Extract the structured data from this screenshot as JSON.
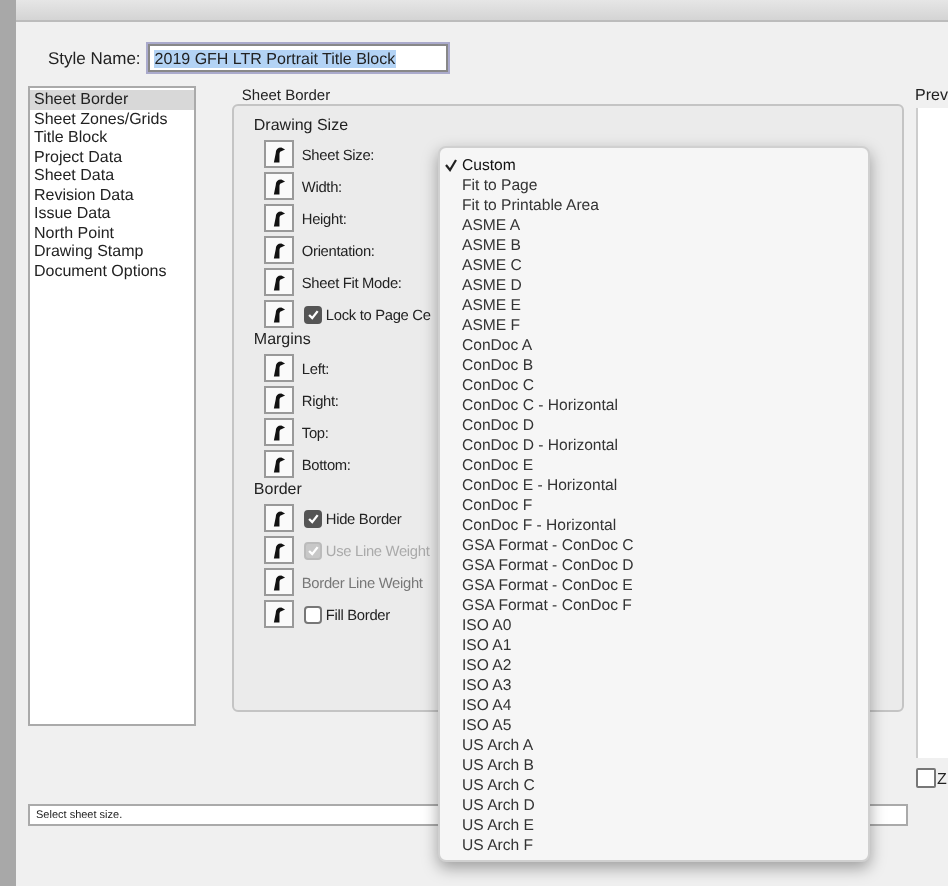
{
  "style_name": {
    "label": "Style Name:",
    "value": "2019 GFH LTR Portrait Title Block"
  },
  "sidebar": {
    "items": [
      {
        "label": "Sheet Border",
        "selected": true
      },
      {
        "label": "Sheet Zones/Grids",
        "selected": false
      },
      {
        "label": "Title Block",
        "selected": false
      },
      {
        "label": "Project Data",
        "selected": false
      },
      {
        "label": "Sheet Data",
        "selected": false
      },
      {
        "label": "Revision Data",
        "selected": false
      },
      {
        "label": "Issue Data",
        "selected": false
      },
      {
        "label": "North Point",
        "selected": false
      },
      {
        "label": "Drawing Stamp",
        "selected": false
      },
      {
        "label": "Document Options",
        "selected": false
      }
    ]
  },
  "panel": {
    "title": "Sheet Border",
    "sections": [
      {
        "title": "Drawing Size",
        "rows": [
          {
            "kind": "label",
            "label": "Sheet Size:",
            "disabled": false
          },
          {
            "kind": "label",
            "label": "Width:",
            "disabled": false
          },
          {
            "kind": "label",
            "label": "Height:",
            "disabled": false
          },
          {
            "kind": "label",
            "label": "Orientation:",
            "disabled": false
          },
          {
            "kind": "label",
            "label": "Sheet Fit Mode:",
            "disabled": false
          },
          {
            "kind": "checkbox",
            "label": "Lock to Page Ce",
            "checked": true,
            "disabled": false
          }
        ]
      },
      {
        "title": "Margins",
        "rows": [
          {
            "kind": "label",
            "label": "Left:",
            "disabled": false
          },
          {
            "kind": "label",
            "label": "Right:",
            "disabled": false
          },
          {
            "kind": "label",
            "label": "Top:",
            "disabled": false
          },
          {
            "kind": "label",
            "label": "Bottom:",
            "disabled": false
          }
        ]
      },
      {
        "title": "Border",
        "rows": [
          {
            "kind": "checkbox",
            "label": "Hide Border",
            "checked": true,
            "disabled": false
          },
          {
            "kind": "checkbox",
            "label": "Use Line Weight",
            "checked": true,
            "disabled": true
          },
          {
            "kind": "label",
            "label": "Border Line Weight",
            "disabled": true
          },
          {
            "kind": "checkbox",
            "label": "Fill Border",
            "checked": false,
            "disabled": false
          }
        ]
      }
    ]
  },
  "preview": {
    "label": "Prev"
  },
  "zoom_checkbox": {
    "label": "Z",
    "checked": false
  },
  "status": "Select sheet size.",
  "dropdown": {
    "items": [
      {
        "label": "Custom",
        "selected": true
      },
      {
        "label": "Fit to Page",
        "selected": false
      },
      {
        "label": "Fit to Printable Area",
        "selected": false
      },
      {
        "label": "ASME A",
        "selected": false
      },
      {
        "label": "ASME B",
        "selected": false
      },
      {
        "label": "ASME C",
        "selected": false
      },
      {
        "label": "ASME D",
        "selected": false
      },
      {
        "label": "ASME E",
        "selected": false
      },
      {
        "label": "ASME F",
        "selected": false
      },
      {
        "label": "ConDoc A",
        "selected": false
      },
      {
        "label": "ConDoc B",
        "selected": false
      },
      {
        "label": "ConDoc C",
        "selected": false
      },
      {
        "label": "ConDoc C - Horizontal",
        "selected": false
      },
      {
        "label": "ConDoc D",
        "selected": false
      },
      {
        "label": "ConDoc D - Horizontal",
        "selected": false
      },
      {
        "label": "ConDoc E",
        "selected": false
      },
      {
        "label": "ConDoc E - Horizontal",
        "selected": false
      },
      {
        "label": "ConDoc F",
        "selected": false
      },
      {
        "label": "ConDoc F - Horizontal",
        "selected": false
      },
      {
        "label": "GSA Format - ConDoc C",
        "selected": false
      },
      {
        "label": "GSA Format - ConDoc D",
        "selected": false
      },
      {
        "label": "GSA Format - ConDoc E",
        "selected": false
      },
      {
        "label": "GSA Format - ConDoc F",
        "selected": false
      },
      {
        "label": "ISO A0",
        "selected": false
      },
      {
        "label": "ISO A1",
        "selected": false
      },
      {
        "label": "ISO A2",
        "selected": false
      },
      {
        "label": "ISO A3",
        "selected": false
      },
      {
        "label": "ISO A4",
        "selected": false
      },
      {
        "label": "ISO A5",
        "selected": false
      },
      {
        "label": "US Arch A",
        "selected": false
      },
      {
        "label": "US Arch B",
        "selected": false
      },
      {
        "label": "US Arch C",
        "selected": false
      },
      {
        "label": "US Arch D",
        "selected": false
      },
      {
        "label": "US Arch E",
        "selected": false
      },
      {
        "label": "US Arch F",
        "selected": false
      }
    ]
  }
}
